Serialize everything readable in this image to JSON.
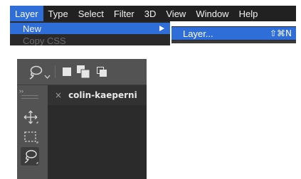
{
  "menubar": {
    "items": [
      "Layer",
      "Type",
      "Select",
      "Filter",
      "3D",
      "View",
      "Window",
      "Help"
    ],
    "active": "Layer"
  },
  "layer_menu": {
    "items": [
      {
        "label": "New",
        "highlighted": true,
        "has_submenu": true
      },
      {
        "label": "Copy CSS",
        "highlighted": false,
        "disabled": true
      }
    ]
  },
  "new_submenu": {
    "items": [
      {
        "label": "Layer...",
        "shortcut": "⇧⌘N",
        "highlighted": true
      }
    ]
  },
  "options_bar": {
    "tool_icon": "lasso-icon",
    "selection_modes": [
      "new-selection-icon",
      "add-to-selection-icon",
      "subtract-from-selection-icon"
    ]
  },
  "toolbar": {
    "collapse_label": "››",
    "tools": [
      "move-tool-icon",
      "rectangular-marquee-tool-icon",
      "lasso-tool-icon"
    ]
  },
  "document": {
    "tab_title": "colin-kaeperni",
    "close_symbol": "×"
  },
  "colors": {
    "menubar_bg": "#212122",
    "highlight": "#2f6ed8",
    "panel_bg": "#535353",
    "canvas_bg": "#2b2b2b"
  }
}
